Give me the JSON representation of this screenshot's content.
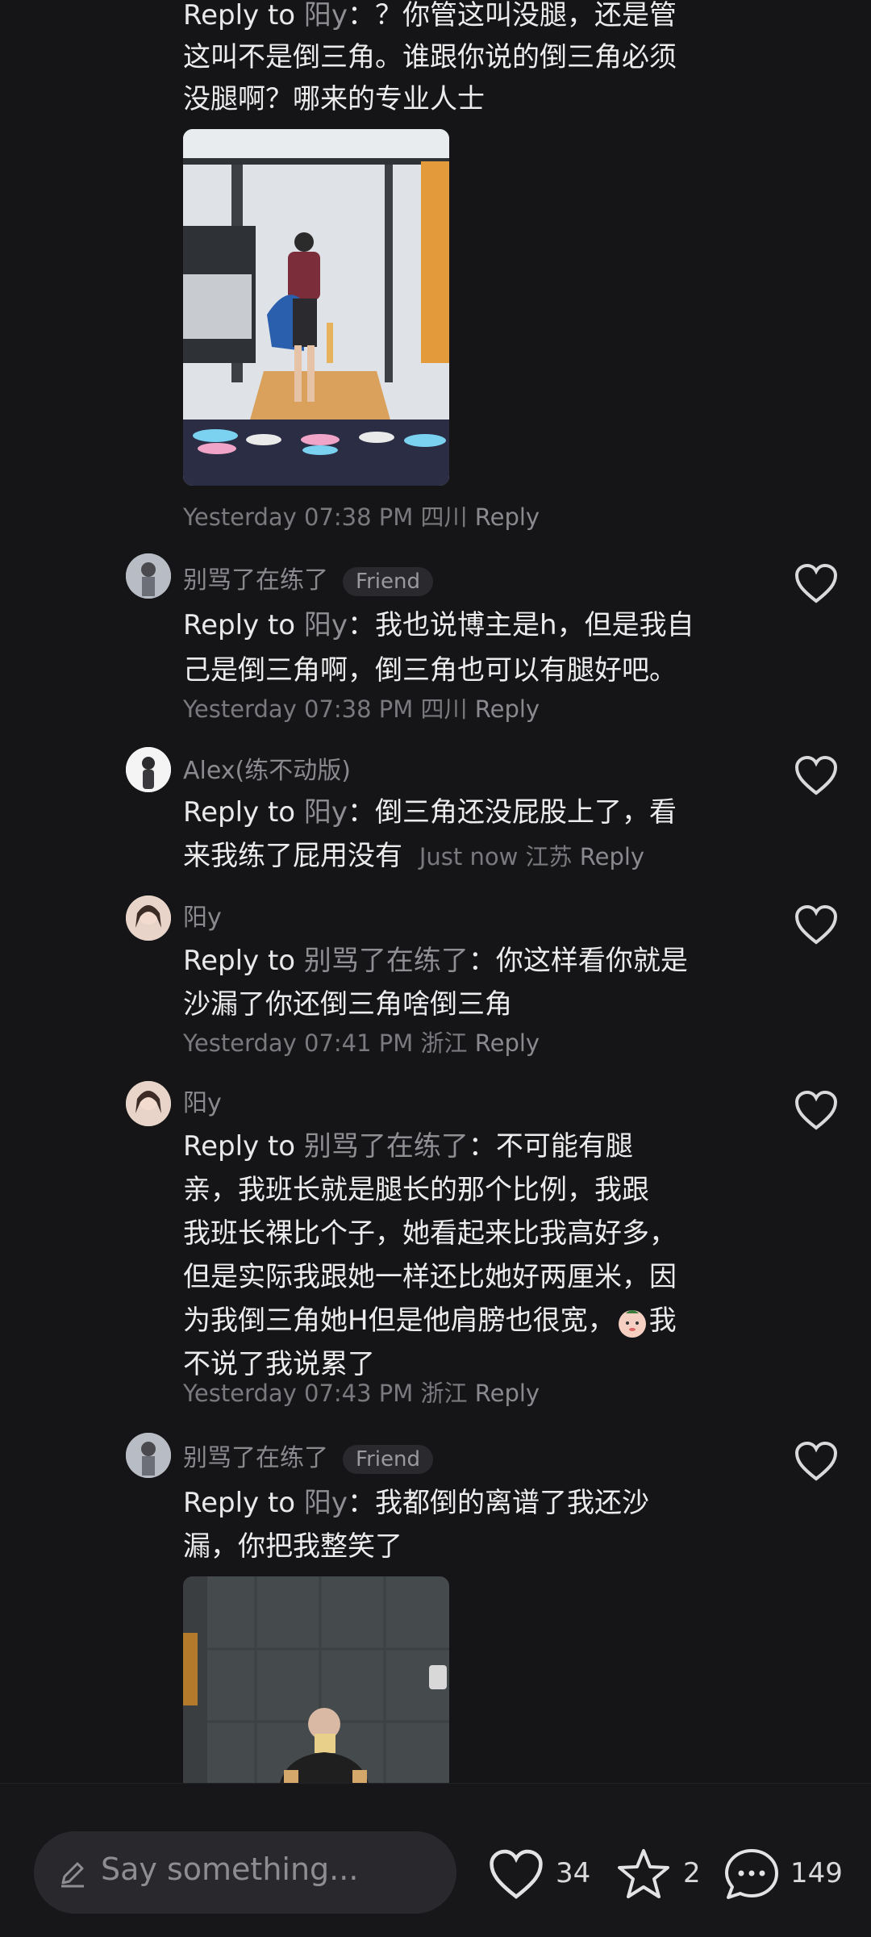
{
  "comments": [
    {
      "reply_prefix": "Reply to",
      "reply_target": "阳y",
      "text_lines": [
        "：？你管这叫没腿，还是管",
        "这叫不是倒三角。谁跟你说的倒三角必须",
        "没腿啊？哪来的专业人士"
      ],
      "meta": {
        "time": "Yesterday 07:38 PM",
        "location": "四川",
        "reply": "Reply"
      }
    },
    {
      "username": "别骂了在练了",
      "badge": "Friend",
      "reply_prefix": "Reply to",
      "reply_target": "阳y",
      "text_lines": [
        "：我也说博主是h，但是我自",
        "己是倒三角啊，倒三角也可以有腿好吧。"
      ],
      "meta": {
        "time": "Yesterday 07:38 PM",
        "location": "四川",
        "reply": "Reply"
      }
    },
    {
      "username": "Alex(练不动版)",
      "reply_prefix": "Reply to",
      "reply_target": "阳y",
      "text_lines": [
        "：倒三角还没屁股上了，看",
        "来我练了屁用没有"
      ],
      "meta": {
        "time": "Just now",
        "location": "江苏",
        "reply": "Reply"
      }
    },
    {
      "username": "阳y",
      "reply_prefix": "Reply to",
      "reply_target": "别骂了在练了",
      "text_lines": [
        "：你这样看你就是",
        "沙漏了你还倒三角啥倒三角"
      ],
      "meta": {
        "time": "Yesterday 07:41 PM",
        "location": "浙江",
        "reply": "Reply"
      }
    },
    {
      "username": "阳y",
      "reply_prefix": "Reply to",
      "reply_target": "别骂了在练了",
      "text_lines": [
        "：不可能有腿",
        "亲，我班长就是腿长的那个比例，我跟",
        "我班长裸比个子，她看起来比我高好多，",
        "但是实际我跟她一样还比她好两厘米，因",
        "为我倒三角她H但是他肩膀也很宽，",
        "不说了我说累了"
      ],
      "emoji_after_line_5": "我",
      "meta": {
        "time": "Yesterday 07:43 PM",
        "location": "浙江",
        "reply": "Reply"
      }
    },
    {
      "username": "别骂了在练了",
      "badge": "Friend",
      "reply_prefix": "Reply to",
      "reply_target": "阳y",
      "text_lines": [
        "：我都倒的离谱了我还沙",
        "漏，你把我整笑了"
      ]
    }
  ],
  "bottom_bar": {
    "input_placeholder": "Say something...",
    "likes": "34",
    "stars": "2",
    "comments": "149"
  },
  "colors": {
    "background": "#151518",
    "text": "#ececec",
    "muted": "#7a7a7e"
  }
}
